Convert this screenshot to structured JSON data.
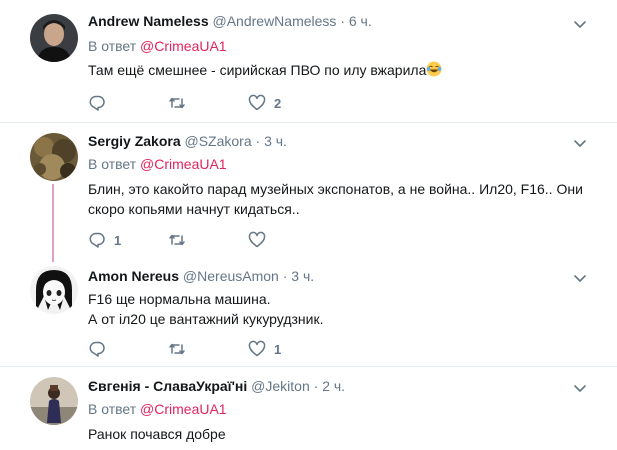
{
  "tweets": [
    {
      "name": "Andrew Nameless",
      "handle": "@AndrewNameless",
      "dot": "·",
      "time": "6 ч.",
      "reply_prefix": "В ответ",
      "reply_to": "@CrimeaUA1",
      "text": "Там ещё смешнее - сирийская ПВО по илу вжарила",
      "replies": "",
      "retweets": "",
      "likes": "2"
    },
    {
      "name": "Sergiy Zakora",
      "handle": "@SZakora",
      "dot": "·",
      "time": "3 ч.",
      "reply_prefix": "В ответ",
      "reply_to": "@CrimeaUA1",
      "text": "Блин,  это какойто парад музейных экспонатов,  а не война.. Ил20, F16.. Они скоро копьями начнут кидаться..",
      "replies": "1",
      "retweets": "",
      "likes": ""
    },
    {
      "name": "Amon Nereus",
      "handle": "@NereusAmon",
      "dot": "·",
      "time": "3 ч.",
      "text_line1": "F16 ще нормальна машина.",
      "text_line2": "А от іл20 це вантажний кукурудзник.",
      "replies": "",
      "retweets": "",
      "likes": "1"
    },
    {
      "name": "Євгенія - СлаваУкраї'ні",
      "handle": "@Jekiton",
      "dot": "·",
      "time": "2 ч.",
      "reply_prefix": "В ответ",
      "reply_to": "@CrimeaUA1",
      "text": "Ранок почався добре"
    }
  ],
  "colors": {
    "accent_link": "#e0245e",
    "muted": "#657786",
    "divider": "#e6ecf0",
    "thread_line": "#e0a0c6"
  },
  "icons": [
    "reply-icon",
    "retweet-icon",
    "like-icon",
    "chevron-down-icon",
    "laughing-emoji-icon"
  ]
}
